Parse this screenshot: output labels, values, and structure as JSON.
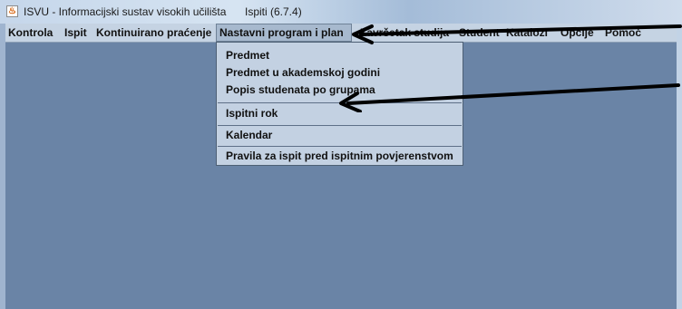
{
  "window": {
    "title": "ISVU - Informacijski sustav visokih učilišta",
    "subtitle": "Ispiti (6.7.4)",
    "icon": "java-app-icon"
  },
  "menubar": {
    "items": [
      {
        "label": "Kontrola",
        "id": "kontrola"
      },
      {
        "label": "Ispit",
        "id": "ispit"
      },
      {
        "label": "Kontinuirano praćenje",
        "id": "kontinuirano-pracenje"
      },
      {
        "label": "Nastavni program i plan",
        "id": "nastavni-program-i-plan",
        "active": true
      },
      {
        "label": "Završetak studija",
        "id": "zavrsetak-studija"
      },
      {
        "label": "Student",
        "id": "student"
      },
      {
        "label": "Katalozi",
        "id": "katalozi"
      },
      {
        "label": "Opcije",
        "id": "opcije"
      },
      {
        "label": "Pomoć",
        "id": "pomoc"
      }
    ]
  },
  "dropdown": {
    "items": [
      {
        "label": "Predmet"
      },
      {
        "label": "Predmet u akademskoj godini"
      },
      {
        "label": "Popis studenata po grupama"
      },
      {
        "label": "Ispitni rok"
      },
      {
        "label": "Kalendar"
      },
      {
        "label": "Pravila za ispit pred ispitnim povjerenstvom"
      }
    ]
  },
  "annotations": {
    "arrow_color": "#000000"
  }
}
